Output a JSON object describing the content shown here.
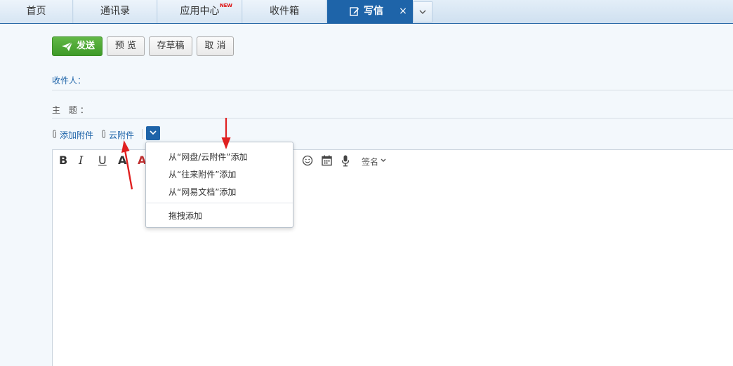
{
  "tabs": {
    "home": "首页",
    "contacts": "通讯录",
    "apps": "应用中心",
    "apps_badge": "NEW",
    "inbox": "收件箱",
    "write": "写信",
    "close": "×"
  },
  "toolbar": {
    "send": "发送",
    "preview": "预 览",
    "draft": "存草稿",
    "cancel": "取 消"
  },
  "fields": {
    "to_label": "收件人：",
    "to_value": "",
    "subject_label": "主 题：",
    "subject_value": ""
  },
  "attachments": {
    "add": "添加附件",
    "cloud": "云附件"
  },
  "editor": {
    "bold": "B",
    "italic": "I",
    "underline": "U",
    "font_color": "A",
    "bg_color": "A",
    "signature": "签名"
  },
  "dropdown": {
    "items": [
      "从“网盘/云附件”添加",
      "从“往来附件”添加",
      "从“网易文档”添加",
      "拖拽添加"
    ]
  },
  "colors": {
    "accent_blue": "#1e64a9",
    "send_green": "#4aa832",
    "arrow_red": "#e02020"
  },
  "icons": {
    "send": "paper-plane-icon",
    "write": "pen-icon",
    "attach": "paperclip-icon",
    "toggle": "chevron-down-icon",
    "emoji": "emoji-icon",
    "calendar": "calendar-icon",
    "mic": "mic-icon"
  }
}
